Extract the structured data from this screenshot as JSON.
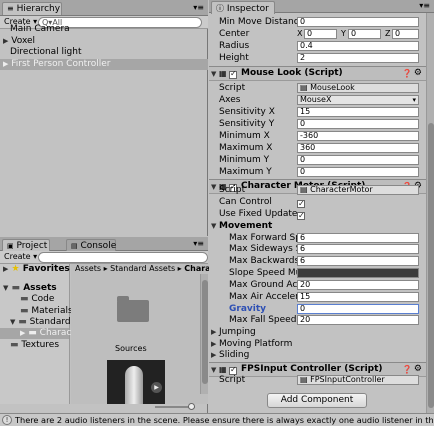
{
  "hierarchy": {
    "tab_label": "Hierarchy",
    "create_label": "Create",
    "search_prefix": "Q▾All",
    "items": [
      {
        "label": "Main Camera",
        "selected": false,
        "expandable": false
      },
      {
        "label": "Voxel",
        "selected": false,
        "expandable": true
      },
      {
        "label": "Directional light",
        "selected": false,
        "expandable": false
      },
      {
        "label": "First Person Controller",
        "selected": true,
        "expandable": true
      }
    ]
  },
  "project": {
    "tab_label": "Project",
    "console_tab_label": "Console",
    "create_label": "Create",
    "favorites_label": "Favorites",
    "assets_label": "Assets",
    "tree": [
      "Code",
      "Materials",
      "Standard A",
      "Characte",
      "Textures"
    ],
    "breadcrumb": [
      "Assets",
      "Standard Assets",
      "Chara"
    ],
    "folder_label": "Sources"
  },
  "inspector": {
    "tab_label": "Inspector",
    "top_rows": [
      {
        "label": "Min Move Distance",
        "value": "0"
      },
      {
        "label": "Radius",
        "value": "0.4"
      },
      {
        "label": "Height",
        "value": "2"
      }
    ],
    "center": {
      "label": "Center",
      "x": "0",
      "y": "0",
      "z": "0"
    },
    "mouse_look": {
      "title": "Mouse Look (Script)",
      "script_label": "Script",
      "script_value": "MouseLook",
      "axes_label": "Axes",
      "axes_value": "MouseX",
      "rows": [
        {
          "label": "Sensitivity X",
          "value": "15"
        },
        {
          "label": "Sensitivity Y",
          "value": "0"
        },
        {
          "label": "Minimum X",
          "value": "-360"
        },
        {
          "label": "Maximum X",
          "value": "360"
        },
        {
          "label": "Minimum Y",
          "value": "0"
        },
        {
          "label": "Maximum Y",
          "value": "0"
        }
      ]
    },
    "character_motor": {
      "title": "Character Motor (Script)",
      "script_label": "Script",
      "script_value": "CharacterMotor",
      "can_control": "Can Control",
      "use_fixed_update": "Use Fixed Update",
      "movement_label": "Movement",
      "movement_rows": [
        {
          "label": "Max Forward Spe",
          "value": "6"
        },
        {
          "label": "Max Sideways Spe",
          "value": "6"
        },
        {
          "label": "Max Backwards S",
          "value": "6"
        },
        {
          "label": "Slope Speed Multi",
          "value": ""
        },
        {
          "label": "Max Ground Accel",
          "value": "20"
        },
        {
          "label": "Max Air Accelerati",
          "value": "15"
        },
        {
          "label": "Gravity",
          "value": "0"
        },
        {
          "label": "Max Fall Speed",
          "value": "20"
        }
      ],
      "foldouts": [
        "Jumping",
        "Moving Platform",
        "Sliding"
      ]
    },
    "fps_input": {
      "title": "FPSInput Controller (Script)",
      "script_label": "Script",
      "script_value": "FPSInputController"
    },
    "add_component_label": "Add Component"
  },
  "status_bar": {
    "message": "There are 2 audio listeners in the scene. Please ensure there is always exactly one audio listener in the scene."
  },
  "colors": {
    "panel_bg": "#c2c2c2",
    "selection": "#a6a6a6",
    "gravity_label": "#2e50b4",
    "slope_field": "#3a3a3a"
  }
}
